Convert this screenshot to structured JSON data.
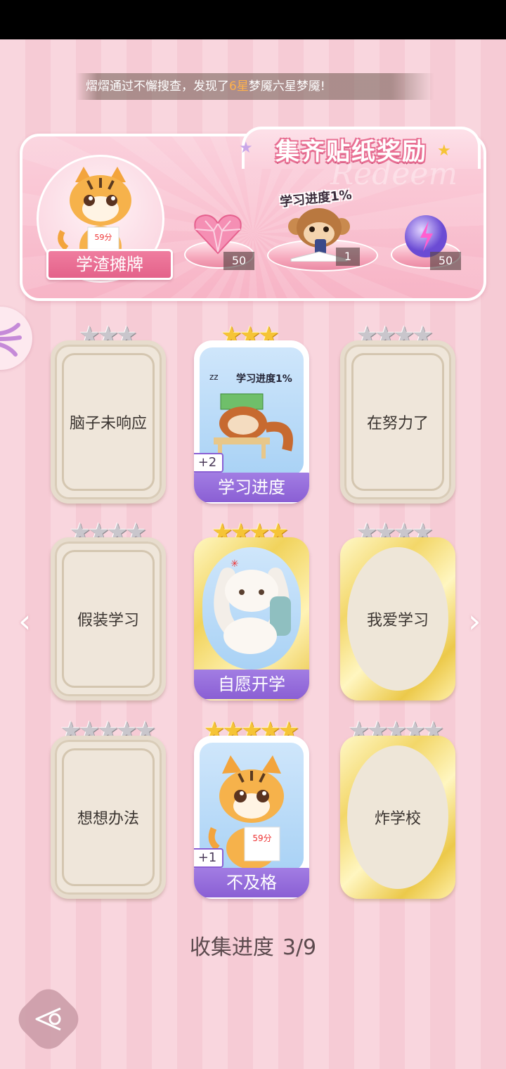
{
  "marquee": {
    "prefix": "熠熠通过不懈搜查，发现了",
    "highlight": "6星",
    "suffix": "梦魇六星梦魇!"
  },
  "reward_panel": {
    "title": "集齐贴纸奖励",
    "badge_name": "学渣摊牌",
    "progress_label": "学习进度1%",
    "rewards": [
      {
        "icon": "pink-heart-gem-icon",
        "count": "50"
      },
      {
        "icon": "monkey-sticker-icon",
        "count": "1"
      },
      {
        "icon": "purple-lightning-orb-icon",
        "count": "50"
      }
    ]
  },
  "cards": [
    {
      "label": "脑子未响应",
      "owned": false,
      "stars": 3,
      "frame": "plain"
    },
    {
      "label": "学习进度",
      "owned": true,
      "stars": 3,
      "frame": "plain",
      "dup": "+2",
      "art_text": "学习进度1%"
    },
    {
      "label": "在努力了",
      "owned": false,
      "stars": 4,
      "frame": "plain"
    },
    {
      "label": "假装学习",
      "owned": false,
      "stars": 4,
      "frame": "plain"
    },
    {
      "label": "自愿开学",
      "owned": true,
      "stars": 4,
      "frame": "gold"
    },
    {
      "label": "我爱学习",
      "owned": false,
      "stars": 4,
      "frame": "gold"
    },
    {
      "label": "想想办法",
      "owned": false,
      "stars": 5,
      "frame": "plain"
    },
    {
      "label": "不及格",
      "owned": true,
      "stars": 5,
      "frame": "plain",
      "dup": "+1",
      "art_text": "59分"
    },
    {
      "label": "炸学校",
      "owned": false,
      "stars": 5,
      "frame": "gold"
    }
  ],
  "tiger_paper_text": "59分",
  "collection": {
    "label": "收集进度",
    "value": "3/9"
  },
  "colors": {
    "accent_pink": "#e86f93",
    "owned_banner": "#8a5fd4",
    "gold_star": "#f6c436"
  }
}
